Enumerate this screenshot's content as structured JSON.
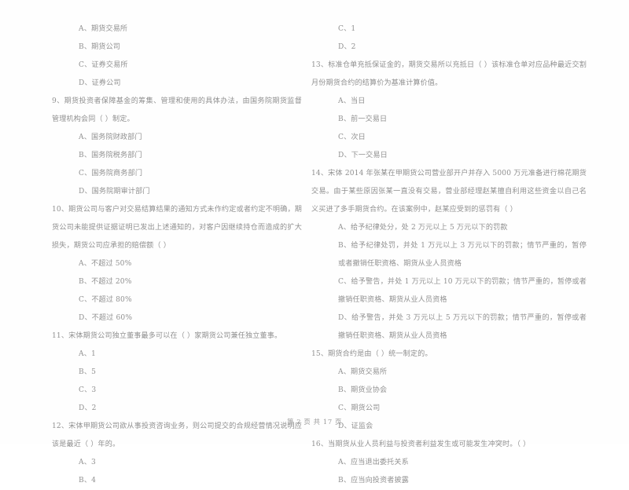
{
  "document": {
    "kind": "scanned-exam-paper",
    "language": "zh-CN",
    "footer": "第 2 页  共 17 页",
    "page_number": "2",
    "total_pages": "17",
    "text_color": "#909090",
    "background_color": "#fefefe"
  },
  "left_column": {
    "continued_options": [
      "A、期货交易所",
      "B、期货公司",
      "C、证券交易所",
      "D、证券公司"
    ],
    "questions": [
      {
        "number": "9",
        "stem": "9、期货投资者保障基金的筹集、管理和使用的具体办法，由国务院期货监督管理机构会同（    ）制定。",
        "options": [
          "A、国务院财政部门",
          "B、国务院税务部门",
          "C、国务院商务部门",
          "D、国务院期审计部门"
        ]
      },
      {
        "number": "10",
        "stem": "10、期货公司与客户对交易结算结果的通知方式未作约定或者约定不明确，期货公司未能提供证据证明已发出上述通知的，对客户因继续持仓而造成的扩大损失，期货公司应承担的赔偿额（    ）",
        "options": [
          "A、不超过 50%",
          "B、不超过 20%",
          "C、不超过 80%",
          "D、不超过 60%"
        ]
      },
      {
        "number": "11",
        "stem": "11、宋体期货公司独立董事最多可以在（     ）家期货公司兼任独立董事。",
        "options": [
          "A、1",
          "B、5",
          "C、3",
          "D、2"
        ]
      },
      {
        "number": "12",
        "stem": "12、宋体甲期货公司欲从事投资咨询业务，则公司提交的合规经营情况说明应该是最近（    ）年的。",
        "options": [
          "A、3",
          "B、4"
        ]
      }
    ]
  },
  "right_column": {
    "continued_options": [
      "C、1",
      "D、2"
    ],
    "questions": [
      {
        "number": "13",
        "stem": "13、标准仓单充抵保证金的，期货交易所以充抵日（      ）该标准仓单对应品种最近交割月份期货合约的结算价为基准计算价值。",
        "options": [
          "A、当日",
          "B、前一交易日",
          "C、次日",
          "D、下一交易日"
        ]
      },
      {
        "number": "14",
        "stem": "14、宋体 2014 年张某在甲期货公司营业部开户并存入 5000 万元准备进行棉花期货交易。由于某些原因张某一直没有交易，营业部经理赵某擅自利用这些资金以自己名义买进了多手期货合约。在该案例中，赵某应受到的惩罚有（      ）",
        "options": [
          "A、给予纪律处分，处 2 万元以上 5 万元以下的罚款",
          "B、给予纪律处罚，并处 1 万元以上 3 万元以下的罚款；情节严重的，暂停或者撤销任职资格、期货从业人员资格",
          "C、给予警告，并处 1 万元以上 10 万元以下的罚款；情节严重的，暂停或者撤销任职资格、期货从业人员资格",
          "D、给予警告，并处 3 万元以上 5 万元以下的罚款；情节严重的，暂停或者撤销任职资格、期货从业人员资格"
        ]
      },
      {
        "number": "15",
        "stem": "15、期货合约是由（     ）统一制定的。",
        "options": [
          "A、期货交易所",
          "B、期货业协会",
          "C、期货公司",
          "D、证监会"
        ]
      },
      {
        "number": "16",
        "stem": "16、当期货从业人员利益与投资者利益发生或可能发生冲突时。（     ）",
        "options": [
          "A、应当退出委托关系",
          "B、应当向投资者披露"
        ]
      }
    ]
  }
}
